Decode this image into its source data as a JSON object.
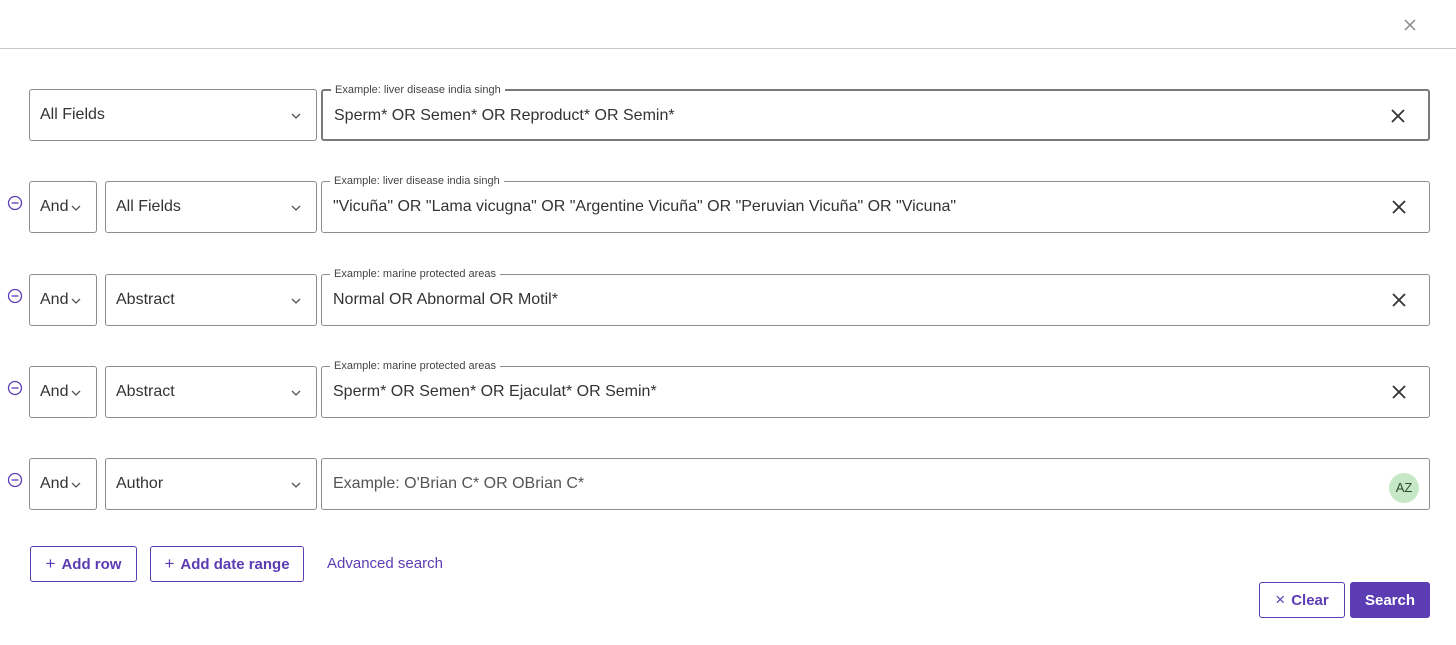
{
  "dialog": {
    "close_icon": "close-icon"
  },
  "rows": [
    {
      "field": "All Fields",
      "hint": "Example: liver disease india singh",
      "query": "Sperm* OR Semen* OR Reproduct* OR Semin*",
      "focused": true
    },
    {
      "operator": "And",
      "field": "All Fields",
      "hint": "Example: liver disease india singh",
      "query": "\"Vicuña\" OR \"Lama vicugna\" OR \"Argentine Vicuña\" OR \"Peruvian Vicuña\" OR \"Vicuna\""
    },
    {
      "operator": "And",
      "field": "Abstract",
      "hint": "Example: marine protected areas",
      "query": "Normal OR Abnormal OR Motil*"
    },
    {
      "operator": "And",
      "field": "Abstract",
      "hint": "Example: marine protected areas",
      "query": "Sperm* OR Semen* OR Ejaculat* OR Semin*"
    },
    {
      "operator": "And",
      "field": "Author",
      "placeholder": "Example: O'Brian C* OR OBrian C*",
      "query": "",
      "az_label": "AZ"
    }
  ],
  "actions": {
    "add_row": "Add row",
    "add_date_range": "Add date range",
    "advanced_search": "Advanced search",
    "clear": "Clear",
    "search": "Search"
  },
  "colors": {
    "accent": "#5b3cb3",
    "az_badge": "#c6e8c6"
  }
}
